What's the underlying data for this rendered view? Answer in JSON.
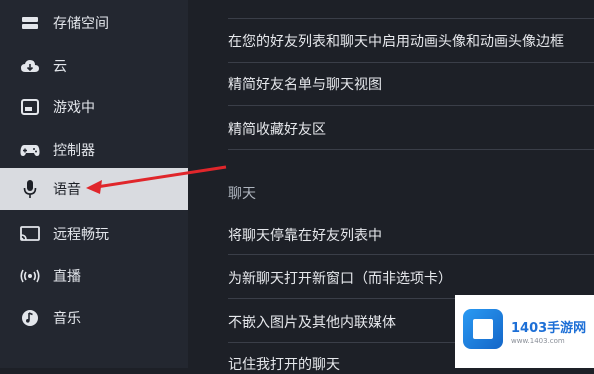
{
  "sidebar": {
    "items": [
      {
        "label": "存储空间",
        "icon": "storage-icon"
      },
      {
        "label": "云",
        "icon": "cloud-icon"
      },
      {
        "label": "游戏中",
        "icon": "in-game-icon"
      },
      {
        "label": "控制器",
        "icon": "controller-icon"
      },
      {
        "label": "语音",
        "icon": "microphone-icon",
        "active": true
      },
      {
        "label": "远程畅玩",
        "icon": "remote-play-icon"
      },
      {
        "label": "直播",
        "icon": "broadcast-icon"
      },
      {
        "label": "音乐",
        "icon": "music-icon"
      }
    ]
  },
  "main": {
    "settings_top": [
      "在您的好友列表和聊天中启用动画头像和动画头像边框",
      "精简好友名单与聊天视图",
      "精简收藏好友区"
    ],
    "section_title": "聊天",
    "settings_chat": [
      "将聊天停靠在好友列表中",
      "为新聊天打开新窗口（而非选项卡）",
      "不嵌入图片及其他内联媒体",
      "记住我打开的聊天"
    ]
  },
  "watermark": {
    "brand": "1403手游网",
    "url": "www.1403.com"
  },
  "colors": {
    "sidebar_bg": "#232730",
    "main_bg": "#1d2027",
    "active_bg": "#d9dbe0",
    "arrow": "#e0262b"
  }
}
